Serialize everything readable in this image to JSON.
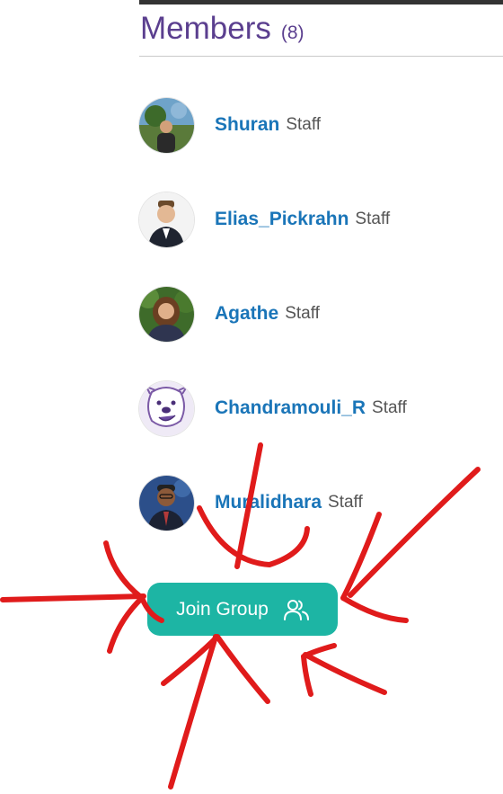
{
  "header": {
    "title": "Members",
    "count": "(8)"
  },
  "members": [
    {
      "name": "Shuran",
      "role": "Staff",
      "avatar_icon": "landscape-photo-avatar"
    },
    {
      "name": "Elias_Pickrahn",
      "role": "Staff",
      "avatar_icon": "portrait-photo-avatar"
    },
    {
      "name": "Agathe",
      "role": "Staff",
      "avatar_icon": "portrait-photo-avatar"
    },
    {
      "name": "Chandramouli_R",
      "role": "Staff",
      "avatar_icon": "dog-sketch-avatar"
    },
    {
      "name": "Muralidhara",
      "role": "Staff",
      "avatar_icon": "portrait-photo-avatar"
    }
  ],
  "join_button": {
    "label": "Join Group",
    "icon": "users-icon"
  },
  "colors": {
    "title": "#5b3f8f",
    "member_link": "#1a75b8",
    "button": "#1db5a4",
    "annotation": "#e01b1b"
  }
}
